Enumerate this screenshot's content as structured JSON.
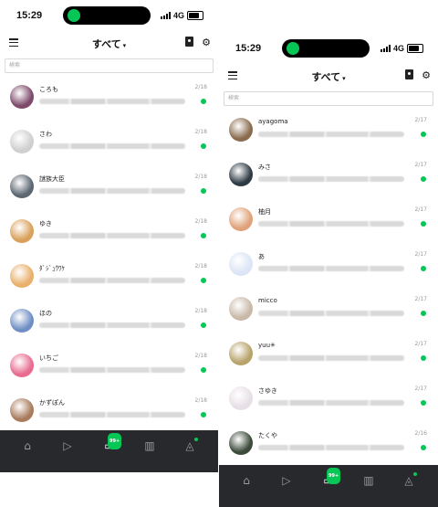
{
  "left": {
    "status": {
      "time": "15:29",
      "net": "4G"
    },
    "header": {
      "title": "すべて",
      "caret": "▾"
    },
    "search": {
      "placeholder": "検索"
    },
    "chats": [
      {
        "name": "ころも",
        "date": "2/18",
        "avatar_color": "#7d4a6a"
      },
      {
        "name": "さわ",
        "date": "2/18",
        "avatar_color": "#cfcfcf"
      },
      {
        "name": "謎族大臣",
        "date": "2/18",
        "avatar_color": "#5b6670"
      },
      {
        "name": "ゆき",
        "date": "2/18",
        "avatar_color": "#d9a15b"
      },
      {
        "name": "ﾀﾞｼﾞｭｳﾜｹ",
        "date": "2/18",
        "avatar_color": "#e8b06b"
      },
      {
        "name": "ほの",
        "date": "2/18",
        "avatar_color": "#6f8fc4"
      },
      {
        "name": "いちご",
        "date": "2/18",
        "avatar_color": "#e86a8f"
      },
      {
        "name": "かずぽん",
        "date": "2/18",
        "avatar_color": "#a87b5c"
      }
    ],
    "tabs": {
      "chat_badge": "99+"
    }
  },
  "right": {
    "status": {
      "time": "15:29",
      "net": "4G"
    },
    "header": {
      "title": "すべて",
      "caret": "▾"
    },
    "search": {
      "placeholder": "検索"
    },
    "chats": [
      {
        "name": "ayagoma",
        "date": "2/17",
        "avatar_color": "#8a6b4e"
      },
      {
        "name": "みさ",
        "date": "2/17",
        "avatar_color": "#2e3a44"
      },
      {
        "name": "柚月",
        "date": "2/17",
        "avatar_color": "#e0a27a"
      },
      {
        "name": "あ",
        "date": "2/17",
        "avatar_color": "#dbe5f5"
      },
      {
        "name": "micco",
        "date": "2/17",
        "avatar_color": "#c9b9a8"
      },
      {
        "name": "yuu✳︎",
        "date": "2/17",
        "avatar_color": "#b7a36b"
      },
      {
        "name": "さゆき",
        "date": "2/17",
        "avatar_color": "#e7dfe6"
      },
      {
        "name": "たくや",
        "date": "2/16",
        "avatar_color": "#3b4a3a"
      }
    ],
    "tabs": {
      "chat_badge": "99+"
    }
  },
  "colors": {
    "accent": "#06c755",
    "tabbar": "#27292d"
  },
  "icons": [
    "menu-icon",
    "add-friend-icon",
    "gear-icon",
    "home-icon",
    "video-icon",
    "chat-icon",
    "stats-icon",
    "bell-icon"
  ]
}
